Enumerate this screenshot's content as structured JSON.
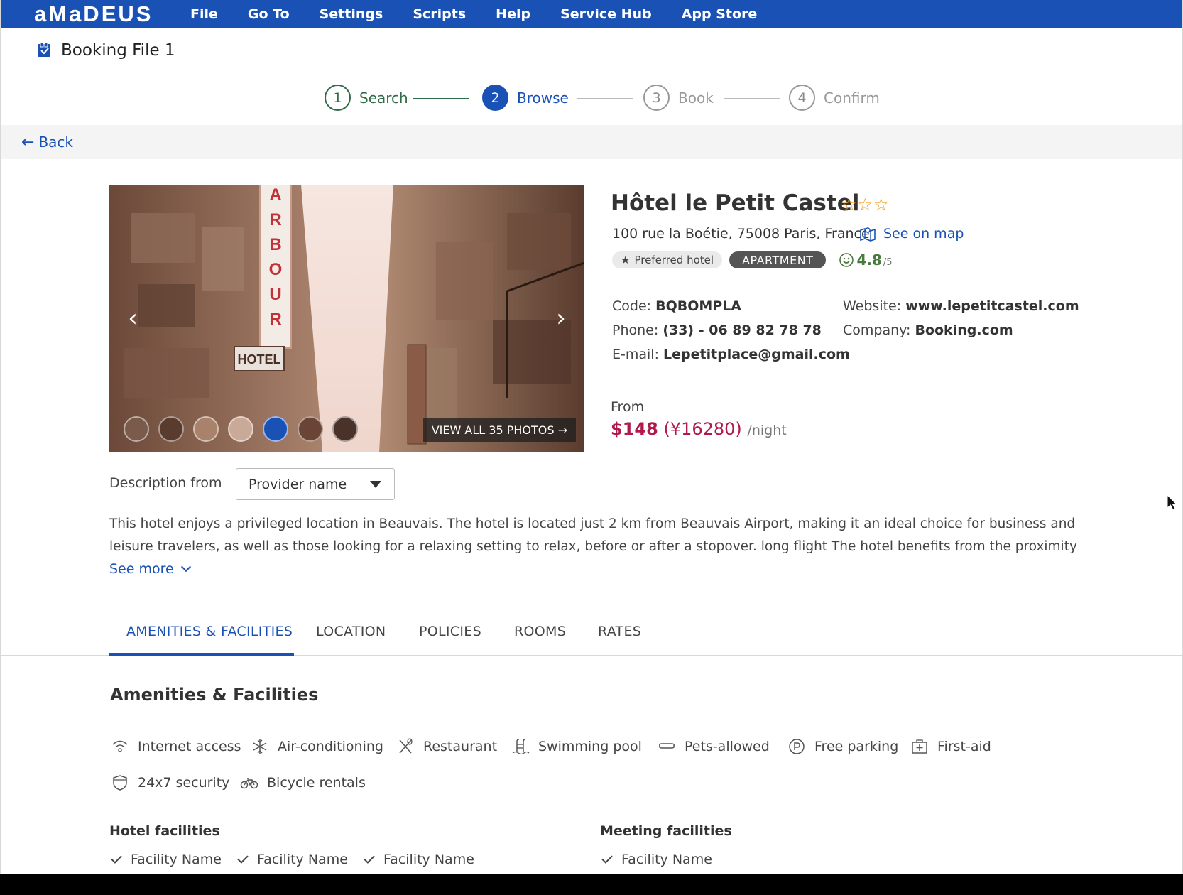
{
  "menubar": {
    "logo": "aMaDEUS",
    "items": [
      "File",
      "Go To",
      "Settings",
      "Scripts",
      "Help",
      "Service Hub",
      "App Store"
    ],
    "color": "#1951b4"
  },
  "file": {
    "title": "Booking File 1",
    "icon": "booking-file-icon"
  },
  "stepper": {
    "steps": [
      {
        "num": "1",
        "label": "Search",
        "state": "done"
      },
      {
        "num": "2",
        "label": "Browse",
        "state": "active"
      },
      {
        "num": "3",
        "label": "Book",
        "state": "todo"
      },
      {
        "num": "4",
        "label": "Confirm",
        "state": "todo"
      }
    ]
  },
  "back": {
    "label": "Back"
  },
  "gallery": {
    "view_all": "VIEW ALL 35 PHOTOS →",
    "thumb_count": 7,
    "selected_thumb": 5,
    "sign_letters": [
      "A",
      "R",
      "B",
      "O",
      "U",
      "R"
    ],
    "hotel_sign": "HOTEL"
  },
  "hotel": {
    "name": "Hôtel le Petit Castel",
    "stars": "☆☆☆",
    "address": "100 rue la Boétie, 75008 Paris, France",
    "map_link": "See on map",
    "preferred": "Preferred hotel",
    "type": "APARTMENT",
    "rating": "4.8",
    "rating_max": "/5",
    "code_label": "Code:",
    "code": "BQBOMPLA",
    "phone_label": "Phone:",
    "phone": "(33) - 06 89 82 78 78",
    "email_label": "E-mail:",
    "email": "Lepetitplace@gmail.com",
    "website_label": "Website:",
    "website": "www.lepetitcastel.com",
    "company_label": "Company:",
    "company": "Booking.com",
    "from_label": "From",
    "price": "$148",
    "price_alt": "(¥16280)",
    "per_night": "/night"
  },
  "description": {
    "from_label": "Description from",
    "provider": "Provider name",
    "text": "This hotel enjoys a privileged location in Beauvais. The hotel is located just 2 km from Beauvais Airport, making it an ideal choice for business and leisure travelers, as well as those looking for a relaxing setting to relax, before or after a stopover. long flight The hotel benefits from the proximity of the",
    "see_more": "See more"
  },
  "tabs": [
    "AMENITIES & FACILITIES",
    "LOCATION",
    "POLICIES",
    "ROOMS",
    "RATES"
  ],
  "amenities": {
    "title": "Amenities & Facilities",
    "items": [
      {
        "label": "Internet access",
        "icon": "wifi-icon"
      },
      {
        "label": "Air-conditioning",
        "icon": "snowflake-icon"
      },
      {
        "label": "Restaurant",
        "icon": "cutlery-icon"
      },
      {
        "label": "Swimming pool",
        "icon": "pool-icon"
      },
      {
        "label": "Pets-allowed",
        "icon": "bone-icon"
      },
      {
        "label": "Free parking",
        "icon": "parking-icon"
      },
      {
        "label": "First-aid",
        "icon": "first-aid-icon"
      },
      {
        "label": "24x7 security",
        "icon": "shield-icon"
      },
      {
        "label": "Bicycle rentals",
        "icon": "bicycle-icon"
      }
    ]
  },
  "hotel_facilities": {
    "title": "Hotel facilities",
    "items": [
      "Facility Name",
      "Facility Name",
      "Facility Name"
    ]
  },
  "meeting_facilities": {
    "title": "Meeting facilities",
    "items": [
      "Facility Name"
    ]
  }
}
